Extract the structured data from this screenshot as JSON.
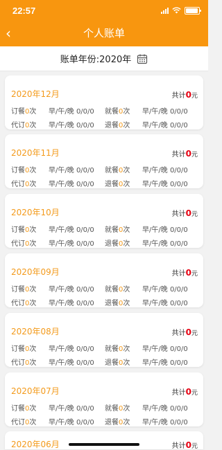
{
  "status": {
    "time": "22:57"
  },
  "header": {
    "title": "个人账单",
    "back_icon": "‹"
  },
  "year_bar": {
    "label": "账单年份:2020年"
  },
  "labels": {
    "order": "订餐",
    "proxy": "代订",
    "dine": "就餐",
    "refund": "退餐",
    "times_unit": "次",
    "meals": "早/午/晚",
    "total_prefix": "共计",
    "currency": "元"
  },
  "months": [
    {
      "month": "2020年12月",
      "total": "0",
      "order_count": "0",
      "order_meals": "0/0/0",
      "dine_count": "0",
      "dine_meals": "0/0/0",
      "proxy_count": "0",
      "proxy_meals": "0/0/0",
      "refund_count": "0",
      "refund_meals": "0/0/0"
    },
    {
      "month": "2020年11月",
      "total": "0",
      "order_count": "0",
      "order_meals": "0/0/0",
      "dine_count": "0",
      "dine_meals": "0/0/0",
      "proxy_count": "0",
      "proxy_meals": "0/0/0",
      "refund_count": "0",
      "refund_meals": "0/0/0"
    },
    {
      "month": "2020年10月",
      "total": "0",
      "order_count": "0",
      "order_meals": "0/0/0",
      "dine_count": "0",
      "dine_meals": "0/0/0",
      "proxy_count": "0",
      "proxy_meals": "0/0/0",
      "refund_count": "0",
      "refund_meals": "0/0/0"
    },
    {
      "month": "2020年09月",
      "total": "0",
      "order_count": "0",
      "order_meals": "0/0/0",
      "dine_count": "0",
      "dine_meals": "0/0/0",
      "proxy_count": "0",
      "proxy_meals": "0/0/0",
      "refund_count": "0",
      "refund_meals": "0/0/0"
    },
    {
      "month": "2020年08月",
      "total": "0",
      "order_count": "0",
      "order_meals": "0/0/0",
      "dine_count": "0",
      "dine_meals": "0/0/0",
      "proxy_count": "0",
      "proxy_meals": "0/0/0",
      "refund_count": "0",
      "refund_meals": "0/0/0"
    },
    {
      "month": "2020年07月",
      "total": "0",
      "order_count": "0",
      "order_meals": "0/0/0",
      "dine_count": "0",
      "dine_meals": "0/0/0",
      "proxy_count": "0",
      "proxy_meals": "0/0/0",
      "refund_count": "0",
      "refund_meals": "0/0/0"
    },
    {
      "month": "2020年06月",
      "total": "0"
    }
  ]
}
